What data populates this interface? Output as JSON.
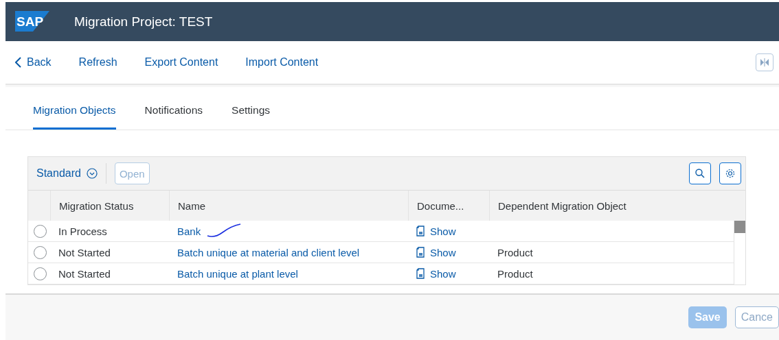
{
  "header": {
    "logo": "SAP",
    "title": "Migration Project: TEST"
  },
  "toolbar": {
    "back": "Back",
    "actions": [
      "Refresh",
      "Export Content",
      "Import Content"
    ]
  },
  "tabs": [
    {
      "label": "Migration Objects",
      "selected": true
    },
    {
      "label": "Notifications",
      "selected": false
    },
    {
      "label": "Settings",
      "selected": false
    }
  ],
  "table": {
    "variant": "Standard",
    "open_button": {
      "label": "Open",
      "disabled": true
    },
    "columns": [
      "Migration Status",
      "Name",
      "Docume...",
      "Dependent Migration Object"
    ],
    "rows": [
      {
        "selected": false,
        "status": "In Process",
        "name": "Bank",
        "document": "Show",
        "dependent": "",
        "annotated": true
      },
      {
        "selected": false,
        "status": "Not Started",
        "name": "Batch unique at material and client level",
        "document": "Show",
        "dependent": "Product",
        "annotated": false
      },
      {
        "selected": false,
        "status": "Not Started",
        "name": "Batch unique at plant level",
        "document": "Show",
        "dependent": "Product",
        "annotated": false
      }
    ]
  },
  "footer": {
    "buttons": [
      {
        "label": "Save",
        "kind": "emphasized",
        "disabled": true
      },
      {
        "label": "Cance",
        "kind": "plain",
        "disabled": true
      }
    ]
  }
}
